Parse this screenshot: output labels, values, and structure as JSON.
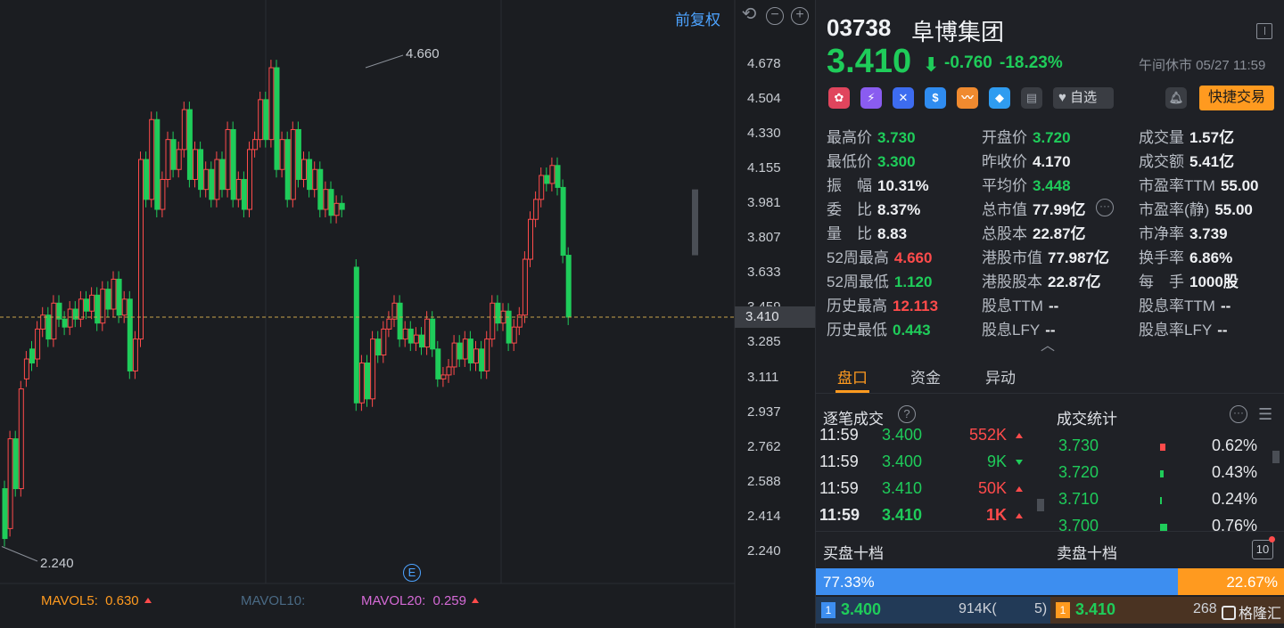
{
  "chart": {
    "fuquan_label": "前复权",
    "high_marker": "4.660",
    "low_marker": "2.240",
    "current_price_tag": "3.410",
    "e_badge": "E",
    "y_ticks": [
      "4.678",
      "4.504",
      "4.330",
      "4.155",
      "3.981",
      "3.807",
      "3.633",
      "3.459",
      "3.285",
      "3.111",
      "2.937",
      "2.762",
      "2.588",
      "2.414",
      "2.240"
    ],
    "mavol5_label": "MAVOL5:",
    "mavol5_value": "0.630",
    "mavol10_label": "MAVOL10:",
    "mavol20_label": "MAVOL20:",
    "mavol20_value": "0.259",
    "colors": {
      "up": "#ff4b4b",
      "down": "#1fcc5a",
      "blue": "#4da3ff",
      "orange": "#ff9a1f"
    }
  },
  "stock": {
    "code": "03738",
    "name": "阜博集团",
    "price": "3.410",
    "change": "-0.760",
    "change_pct": "-18.23%",
    "status": "午间休市 05/27 11:59",
    "watch_label": "自选",
    "quick_trade_label": "快捷交易"
  },
  "quote": [
    [
      {
        "l": "最高价",
        "v": "3.730",
        "c": "green"
      },
      {
        "l": "开盘价",
        "v": "3.720",
        "c": "green"
      },
      {
        "l": "成交量",
        "v": "1.57亿",
        "c": "white"
      }
    ],
    [
      {
        "l": "最低价",
        "v": "3.300",
        "c": "green"
      },
      {
        "l": "昨收价",
        "v": "4.170",
        "c": "white"
      },
      {
        "l": "成交额",
        "v": "5.41亿",
        "c": "white"
      }
    ],
    [
      {
        "l": "振　幅",
        "v": "10.31%",
        "c": "white"
      },
      {
        "l": "平均价",
        "v": "3.448",
        "c": "green"
      },
      {
        "l": "市盈率TTM",
        "v": "55.00",
        "c": "white"
      }
    ],
    [
      {
        "l": "委　比",
        "v": "8.37%",
        "c": "white"
      },
      {
        "l": "总市值",
        "v": "77.99亿",
        "c": "white"
      },
      {
        "l": "市盈率(静)",
        "v": "55.00",
        "c": "white"
      }
    ],
    [
      {
        "l": "量　比",
        "v": "8.83",
        "c": "white"
      },
      {
        "l": "总股本",
        "v": "22.87亿",
        "c": "white"
      },
      {
        "l": "市净率",
        "v": "3.739",
        "c": "white"
      }
    ],
    [
      {
        "l": "52周最高",
        "v": "4.660",
        "c": "red"
      },
      {
        "l": "港股市值",
        "v": "77.987亿",
        "c": "white"
      },
      {
        "l": "换手率",
        "v": "6.86%",
        "c": "white"
      }
    ],
    [
      {
        "l": "52周最低",
        "v": "1.120",
        "c": "green"
      },
      {
        "l": "港股股本",
        "v": "22.87亿",
        "c": "white"
      },
      {
        "l": "每　手",
        "v": "1000股",
        "c": "white"
      }
    ],
    [
      {
        "l": "历史最高",
        "v": "12.113",
        "c": "red"
      },
      {
        "l": "股息TTM",
        "v": "--",
        "c": "white"
      },
      {
        "l": "股息率TTM",
        "v": "--",
        "c": "white"
      }
    ],
    [
      {
        "l": "历史最低",
        "v": "0.443",
        "c": "green"
      },
      {
        "l": "股息LFY",
        "v": "--",
        "c": "white"
      },
      {
        "l": "股息率LFY",
        "v": "--",
        "c": "white"
      }
    ]
  ],
  "tabs": [
    "盘口",
    "资金",
    "异动"
  ],
  "trades_title": "逐笔成交",
  "stats_title": "成交统计",
  "trades": [
    {
      "t": "11:59",
      "p": "3.400",
      "v": "552K",
      "dir": "up"
    },
    {
      "t": "11:59",
      "p": "3.400",
      "v": "9K",
      "dir": "down"
    },
    {
      "t": "11:59",
      "p": "3.410",
      "v": "50K",
      "dir": "up"
    },
    {
      "t": "11:59",
      "p": "3.410",
      "v": "1K",
      "dir": "up"
    }
  ],
  "stats": [
    {
      "p": "3.730",
      "pct": "0.62%",
      "bar": "red"
    },
    {
      "p": "3.720",
      "pct": "0.43%",
      "bar": "green"
    },
    {
      "p": "3.710",
      "pct": "0.24%",
      "bar": "green"
    },
    {
      "p": "3.700",
      "pct": "0.76%",
      "bar": "green"
    }
  ],
  "book": {
    "bid_title": "买盘十档",
    "ask_title": "卖盘十档",
    "depth_btn": "10",
    "bid_pct": "77.33%",
    "ask_pct": "22.67%",
    "bid1_idx": "1",
    "bid1_price": "3.400",
    "bid1_vol": "914K(",
    "bid1_cnt": "5)",
    "ask1_idx": "1",
    "ask1_price": "3.410",
    "ask1_vol": "268",
    "watermark": "格隆汇"
  }
}
